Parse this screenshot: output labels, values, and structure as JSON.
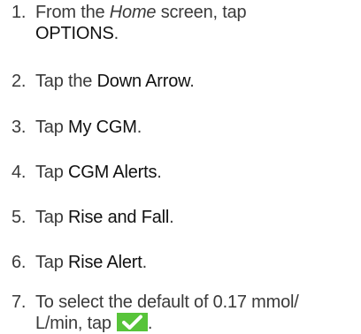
{
  "steps": [
    {
      "number": "1.",
      "line1_prefix": "From the ",
      "line1_emphasis": "Home",
      "line1_suffix": " screen, tap",
      "line2_ui": "OPTIONS",
      "line2_suffix": "."
    },
    {
      "number": "2.",
      "prefix": "Tap the ",
      "ui": "Down Arrow",
      "suffix": "."
    },
    {
      "number": "3.",
      "prefix": "Tap ",
      "ui": "My CGM",
      "suffix": "."
    },
    {
      "number": "4.",
      "prefix": "Tap ",
      "ui": "CGM Alerts",
      "suffix": "."
    },
    {
      "number": "5.",
      "prefix": "Tap ",
      "ui": "Rise and Fall",
      "suffix": "."
    },
    {
      "number": "6.",
      "prefix": "Tap ",
      "ui": "Rise Alert",
      "suffix": "."
    },
    {
      "number": "7.",
      "line1": "To select the default of 0.17 mmol/",
      "line2_prefix": "L/min, tap",
      "line2_suffix": ".",
      "button_icon": "checkmark-icon",
      "button_color": "#58c43a"
    }
  ]
}
